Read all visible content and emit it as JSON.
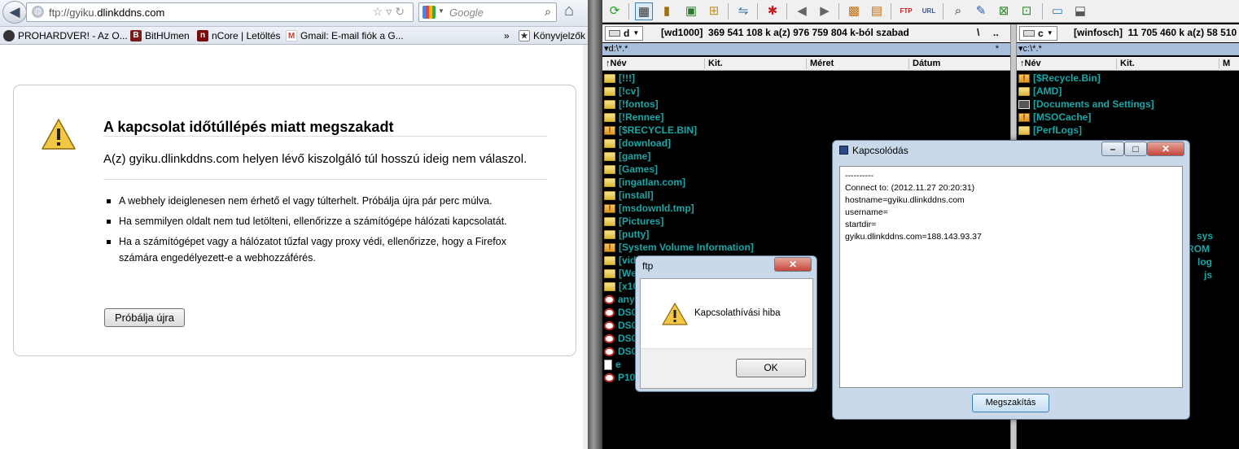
{
  "browser": {
    "url_prefix": "ftp://gyiku.",
    "url_domain": "dlinkddns.com",
    "search_placeholder": "Google",
    "bookmarks": [
      {
        "label": "PROHARDVER! - Az O...",
        "color": "#333333",
        "icon": "P"
      },
      {
        "label": "BitHUmen",
        "color": "#7a1a1a",
        "icon": "B"
      },
      {
        "label": "nCore | Letöltés",
        "color": "#7a0a0a",
        "icon": "n"
      },
      {
        "label": "Gmail: E-mail fiók a G...",
        "color": "#d83a2a",
        "icon": "M"
      }
    ],
    "bookmarks_overflow": "»",
    "bookmarks_folder": "Könyvjelzők"
  },
  "error_page": {
    "title": "A kapcsolat időtúllépés miatt megszakadt",
    "description": "A(z) gyiku.dlinkddns.com helyen lévő kiszolgáló túl hosszú ideig nem válaszol.",
    "bullets": [
      "A webhely ideiglenesen nem érhető el vagy túlterhelt. Próbálja újra pár perc múlva.",
      "Ha semmilyen oldalt nem tud letölteni, ellenőrizze a számítógépe hálózati kapcsolatát.",
      "Ha a számítógépet vagy a hálózatot tűzfal vagy proxy védi, ellenőrizze, hogy a Firefox számára engedélyezett-e a webhozzáférés."
    ],
    "retry_label": "Próbálja újra"
  },
  "commander": {
    "left": {
      "drive": "d",
      "label": "[wd1000]",
      "info": "369 541 108 k a(z) 976 759 804 k-ból szabad",
      "root_btn": "\\",
      "up_btn": "..",
      "path": "▾d:\\*.*",
      "path_star": "*",
      "columns": [
        "↑Név",
        "Kit.",
        "Méret",
        "Dátum"
      ],
      "files": [
        {
          "name": "[!!!]",
          "icon": "folder"
        },
        {
          "name": "[!cv]",
          "icon": "folder"
        },
        {
          "name": "[!fontos]",
          "icon": "folder"
        },
        {
          "name": "[!Rennee]",
          "icon": "folder"
        },
        {
          "name": "[$RECYCLE.BIN]",
          "icon": "hidden"
        },
        {
          "name": "[download]",
          "icon": "folder"
        },
        {
          "name": "[game]",
          "icon": "folder"
        },
        {
          "name": "[Games]",
          "icon": "folder"
        },
        {
          "name": "[ingatlan.com]",
          "icon": "folder"
        },
        {
          "name": "[install]",
          "icon": "folder"
        },
        {
          "name": "[msdownld.tmp]",
          "icon": "hidden"
        },
        {
          "name": "[Pictures]",
          "icon": "folder"
        },
        {
          "name": "[putty]",
          "icon": "folder"
        },
        {
          "name": "[System Volume Information]",
          "icon": "hidden"
        },
        {
          "name": "[vid",
          "icon": "folder"
        },
        {
          "name": "[We",
          "icon": "folder"
        },
        {
          "name": "[x10",
          "icon": "folder"
        },
        {
          "name": "any",
          "icon": "eye"
        },
        {
          "name": "DS0",
          "icon": "eye"
        },
        {
          "name": "DS0",
          "icon": "eye"
        },
        {
          "name": "DS0",
          "icon": "eye"
        },
        {
          "name": "DS0",
          "icon": "eye"
        },
        {
          "name": "e",
          "icon": "doc"
        },
        {
          "name": "P10",
          "icon": "eye"
        }
      ]
    },
    "right": {
      "drive": "c",
      "label": "[winfosch]",
      "info": "11 705 460 k a(z) 58 510 33",
      "path": "▾c:\\*.*",
      "columns": [
        "↑Név",
        "Kit.",
        "M"
      ],
      "files": [
        {
          "name": "[$Recycle.Bin]",
          "icon": "hidden"
        },
        {
          "name": "[AMD]",
          "icon": "folder"
        },
        {
          "name": "[Documents and Settings]",
          "icon": "sys"
        },
        {
          "name": "[MSOCache]",
          "icon": "hidden"
        },
        {
          "name": "[PerfLogs]",
          "icon": "folder"
        }
      ],
      "ext_fragments": [
        "sys",
        "ROM",
        "log",
        "js"
      ]
    }
  },
  "connect_dialog": {
    "title": "Kapcsolódás",
    "log": "----------\nConnect to: (2012.11.27 20:20:31)\nhostname=gyiku.dlinkddns.com\nusername=\nstartdir=\ngyiku.dlinkddns.com=188.143.93.37",
    "disconnect_label": "Megszakítás"
  },
  "ftp_dialog": {
    "title": "ftp",
    "message": "Kapcsolathívási hiba",
    "ok_label": "OK"
  }
}
